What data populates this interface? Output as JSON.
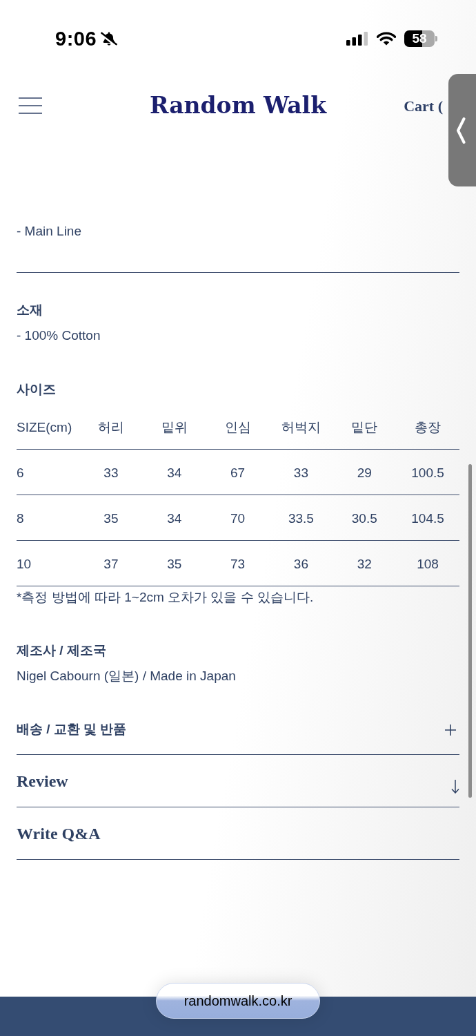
{
  "status_bar": {
    "time": "9:06",
    "battery": "58"
  },
  "header": {
    "logo": "Random Walk",
    "cart": "Cart ("
  },
  "details": {
    "line": "- Main Line",
    "material": {
      "heading": "소재",
      "text": "- 100% Cotton"
    },
    "size": {
      "heading": "사이즈",
      "table": {
        "columns": [
          "SIZE(cm)",
          "허리",
          "밑위",
          "인심",
          "허벅지",
          "밑단",
          "총장"
        ],
        "rows": [
          [
            "6",
            "33",
            "34",
            "67",
            "33",
            "29",
            "100.5"
          ],
          [
            "8",
            "35",
            "34",
            "70",
            "33.5",
            "30.5",
            "104.5"
          ],
          [
            "10",
            "37",
            "35",
            "73",
            "36",
            "32",
            "108"
          ]
        ]
      },
      "note": "*측정 방법에 따라 1~2cm 오차가 있을 수 있습니다."
    },
    "maker": {
      "heading": "제조사 / 제조국",
      "text": "Nigel Cabourn (일본) / Made in Japan"
    }
  },
  "sections": [
    {
      "kind": "expand",
      "label": "배송 / 교환 및 반품",
      "expanded": false
    },
    {
      "kind": "link",
      "label": "Review"
    },
    {
      "kind": "plain",
      "label": "Write Q&A"
    }
  ],
  "address_bar": {
    "url": "randomwalk.co.kr"
  }
}
